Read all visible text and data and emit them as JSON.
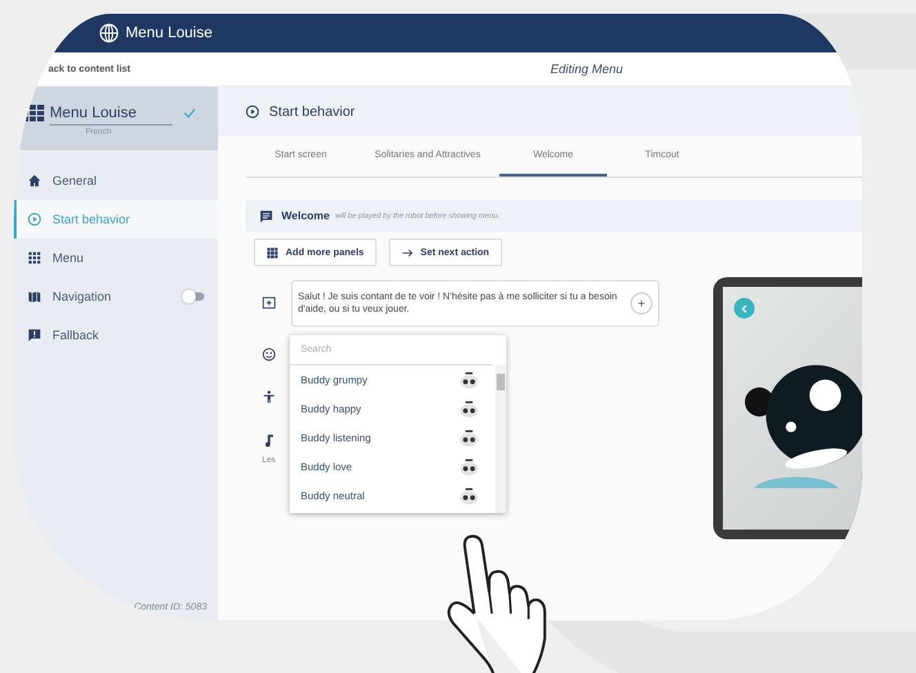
{
  "top_bar": {
    "title": "Menu Louise"
  },
  "sub_bar": {
    "back_link": "ack to content list",
    "title": "Editing Menu"
  },
  "sidebar": {
    "content_name": "Menu Louise",
    "confirmed": true,
    "language": "French",
    "items": [
      {
        "label": "General",
        "kind": "home",
        "selected": false
      },
      {
        "label": "Start behavior",
        "kind": "play",
        "selected": true
      },
      {
        "label": "Menu",
        "kind": "grid",
        "selected": false
      },
      {
        "label": "Navigation",
        "kind": "map",
        "selected": false,
        "toggle": {
          "on": false
        }
      },
      {
        "label": "Fallback",
        "kind": "alert",
        "selected": false
      }
    ],
    "content_id": "Content ID: 5083"
  },
  "main": {
    "title": "Start behavior",
    "tabs": [
      {
        "label": "Start screen",
        "selected": false
      },
      {
        "label": "Solitaries and Attractives",
        "selected": false
      },
      {
        "label": "Welcome",
        "selected": true
      },
      {
        "label": "Timcout",
        "selected": false
      }
    ],
    "section": {
      "title": "Welcome",
      "note": "will be played by the robot before showing menu."
    },
    "buttons": [
      {
        "label": "Add more panels",
        "kind": "panels"
      },
      {
        "label": "Set next action",
        "kind": "arrow"
      }
    ],
    "rows": [
      {
        "kind": "speech",
        "text": "Salut ! Je suis contant de te voir ! N'hésite pas à me solliciter si tu a besoin d'aide, ou si tu veux jouer."
      },
      {
        "kind": "face"
      },
      {
        "kind": "body"
      },
      {
        "kind": "music",
        "caption": "Les"
      }
    ],
    "dropdown": {
      "placeholder": "Search",
      "options": [
        {
          "label": "Buddy grumpy"
        },
        {
          "label": "Buddy happy"
        },
        {
          "label": "Buddy listening"
        },
        {
          "label": "Buddy love"
        },
        {
          "label": "Buddy neutral"
        }
      ]
    }
  }
}
